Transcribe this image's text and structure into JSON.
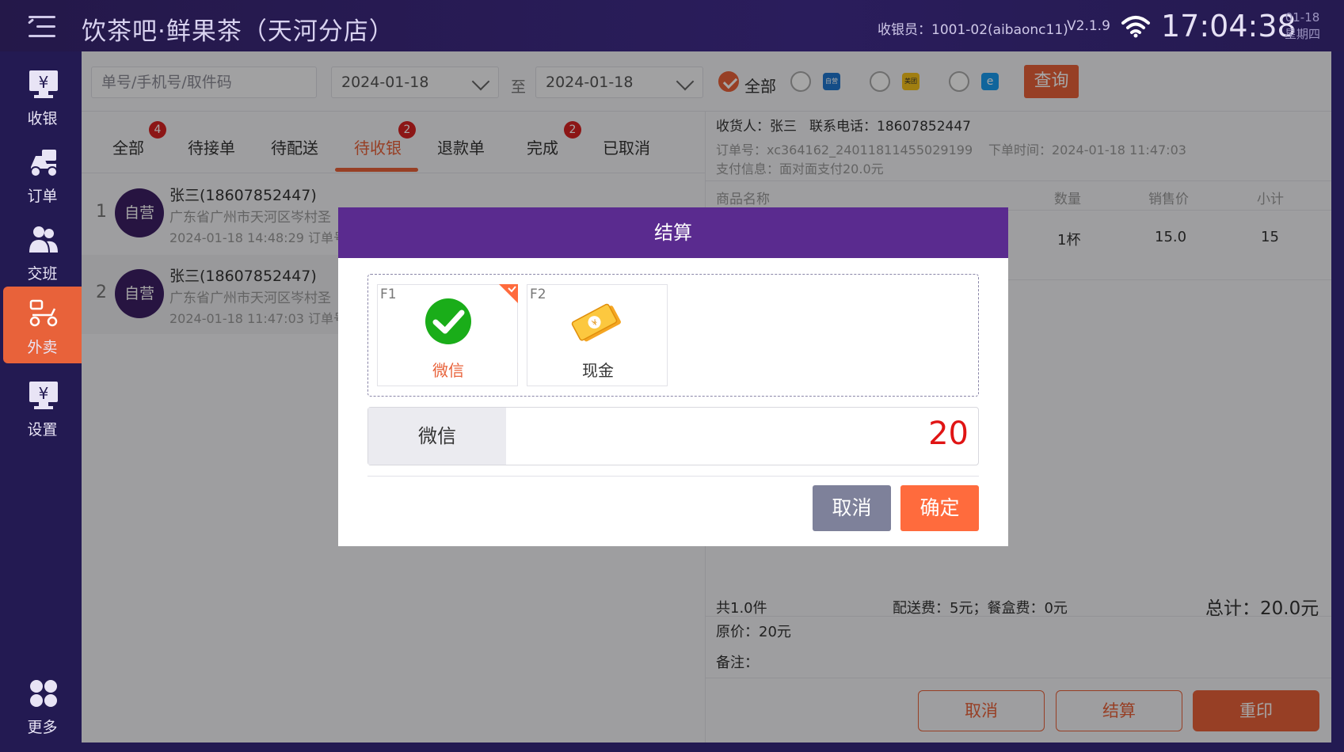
{
  "header": {
    "store_title": "饮茶吧·鲜果茶（天河分店）",
    "cashier": "收银员：1001-02(aibaonc11)",
    "version": "V2.1.9",
    "time": "17:04:38",
    "date": "01-18",
    "weekday": "星期四"
  },
  "sidebar": {
    "items": [
      {
        "label": "收银",
        "icon": "cash-register-icon"
      },
      {
        "label": "订单",
        "icon": "delivery-icon"
      },
      {
        "label": "交班",
        "icon": "staff-icon"
      },
      {
        "label": "外卖",
        "icon": "scooter-icon",
        "active": true
      },
      {
        "label": "设置",
        "icon": "settings-cash-icon"
      }
    ],
    "more_label": "更多"
  },
  "filter": {
    "search_placeholder": "单号/手机号/取件码",
    "date_from": "2024-01-18",
    "to_label": "至",
    "date_to": "2024-01-18",
    "all_label": "全部",
    "sources": [
      "自营",
      "美团",
      "饿了么"
    ],
    "query_label": "查询"
  },
  "tabs": [
    {
      "label": "全部",
      "badge": "4"
    },
    {
      "label": "待接单",
      "badge": ""
    },
    {
      "label": "待配送",
      "badge": ""
    },
    {
      "label": "待收银",
      "badge": "2",
      "active": true
    },
    {
      "label": "退款单",
      "badge": ""
    },
    {
      "label": "完成",
      "badge": "2"
    },
    {
      "label": "已取消",
      "badge": ""
    }
  ],
  "orders": [
    {
      "index": "1",
      "tag": "自营",
      "name": "张三(18607852447)",
      "address": "广东省广州市天河区岑村圣",
      "time": "2024-01-18 14:48:29  订单号"
    },
    {
      "index": "2",
      "tag": "自营",
      "name": "张三(18607852447)",
      "address": "广东省广州市天河区岑村圣",
      "time": "2024-01-18 11:47:03  订单号"
    }
  ],
  "detail": {
    "receiver": "收货人：张三",
    "phone": "联系电话：18607852447",
    "order_no": "订单号：xc364162_24011811455029199",
    "order_time": "下单时间：2024-01-18 11:47:03",
    "pay_info": "支付信息：面对面支付20.0元",
    "columns": [
      "商品名称",
      "数量",
      "销售价",
      "小计"
    ],
    "item": {
      "qty": "1杯",
      "price": "15.0",
      "subtotal": "15"
    },
    "count": "共1.0件",
    "fees": "配送费：5元；餐盒费：0元",
    "total": "总计：20.0元",
    "original": "原价：20元",
    "remark": "备注：",
    "buttons": {
      "cancel": "取消",
      "settle": "结算",
      "reprint": "重印"
    }
  },
  "modal": {
    "title": "结算",
    "methods": [
      {
        "key": "F1",
        "name": "微信",
        "icon": "wechat-icon",
        "selected": true
      },
      {
        "key": "F2",
        "name": "现金",
        "icon": "cash-icon",
        "selected": false
      }
    ],
    "selected_method": "微信",
    "amount": "20",
    "cancel_label": "取消",
    "confirm_label": "确定"
  },
  "colors": {
    "accent": "#e8623a",
    "modal_header": "#5a2b8f",
    "sidebar_bg": "#231a52",
    "wechat_green": "#1aad19",
    "amount_red": "#e01414"
  }
}
